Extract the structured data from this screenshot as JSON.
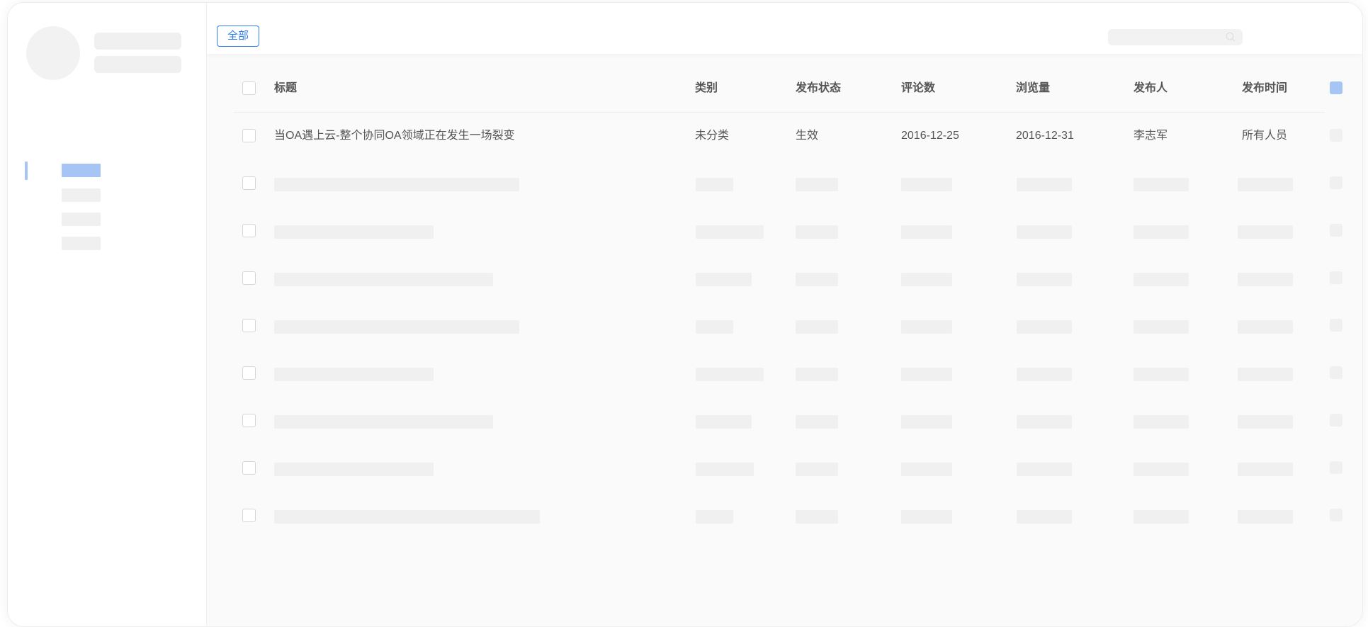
{
  "toolbar": {
    "filter_all_label": "全部"
  },
  "table": {
    "headers": [
      "标题",
      "类别",
      "发布状态",
      "评论数",
      "浏览量",
      "发布人",
      "发布时间"
    ],
    "rows": [
      [
        "当OA遇上云-整个协同OA领域正在发生一场裂变",
        "未分类",
        "生效",
        "2016-12-25",
        "2016-12-31",
        "李志军",
        "所有人员"
      ]
    ]
  },
  "colors": {
    "accent": "#2f80ed",
    "accent_light": "#a6c4f4",
    "skeleton": "#f0f0f0"
  },
  "icons": {
    "search": "search-icon",
    "column_settings": "column-settings-icon"
  }
}
